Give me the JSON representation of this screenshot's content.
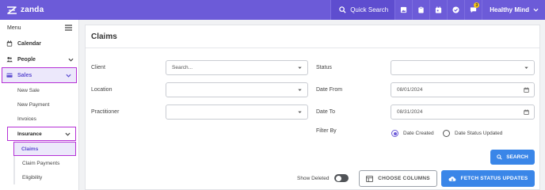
{
  "topbar": {
    "brand": "zanda",
    "quick_search": "Quick Search",
    "notification_count": "3",
    "user_name": "Healthy Mind",
    "icons": [
      "image-icon",
      "clipboard-icon",
      "calendar-icon",
      "check-circle-icon",
      "chat-icon"
    ]
  },
  "sidebar": {
    "menu_label": "Menu",
    "calendar": "Calendar",
    "people": "People",
    "sales": "Sales",
    "sales_items": [
      "New Sale",
      "New Payment",
      "Invoices"
    ],
    "insurance": "Insurance",
    "insurance_items": [
      "Claims",
      "Claim Payments",
      "Eligibility"
    ]
  },
  "main": {
    "title": "Claims",
    "labels": {
      "client": "Client",
      "location": "Location",
      "practitioner": "Practitioner",
      "status": "Status",
      "date_from": "Date From",
      "date_to": "Date To",
      "filter_by": "Filter By"
    },
    "client_placeholder": "Search...",
    "date_from_value": "08/01/2024",
    "date_to_value": "08/31/2024",
    "filter_options": [
      "Date Created",
      "Date Status Updated"
    ],
    "filter_selected": "Date Created",
    "search_button": "SEARCH",
    "show_deleted": "Show Deleted",
    "show_deleted_on": false,
    "choose_columns": "CHOOSE COLUMNS",
    "fetch_status": "FETCH STATUS UPDATES"
  },
  "colors": {
    "topbar": "#6c5bd8",
    "accent_blue": "#3a86e8",
    "highlight_border": "#b531d6"
  }
}
